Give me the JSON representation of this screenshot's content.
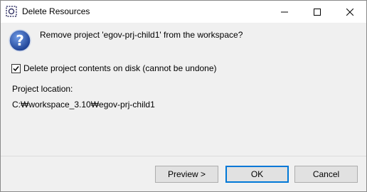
{
  "window": {
    "title": "Delete Resources",
    "icon": "eclipse-app-icon"
  },
  "dialog": {
    "message": "Remove project 'egov-prj-child1' from the workspace?",
    "checkbox": {
      "label": "Delete project contents on disk (cannot be undone)",
      "checked": true
    },
    "location_label": "Project location:",
    "location_value": "C:₩workspace_3.10₩egov-prj-child1"
  },
  "buttons": {
    "preview": "Preview >",
    "ok": "OK",
    "cancel": "Cancel"
  },
  "colors": {
    "accent": "#0078d7",
    "question_icon": "#2f5fb3"
  }
}
